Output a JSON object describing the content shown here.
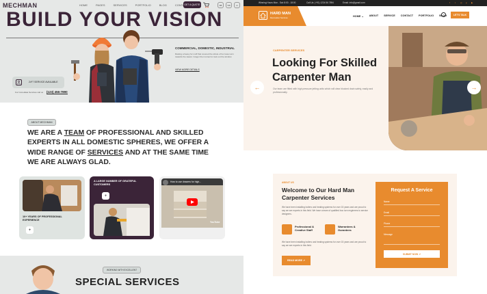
{
  "mechman": {
    "logo": "MECHMAN",
    "nav": [
      "HOME",
      "PAGES",
      "SERVICES",
      "PORTFOLIO",
      "BLOG",
      "CONTACT"
    ],
    "cta": "GET A QUOTE",
    "social": [
      "FB",
      "TW",
      "LI"
    ],
    "hero_title": "BUILD YOUR VISION",
    "hero_side_heading": "COMMERCIAL, DOMESTIC, INDUSTRIAL",
    "hero_side_text": "Raising a heavy fur muff that covered the whole of her lower arm towards the viewer. Gregor then turned to look out the window.",
    "hero_side_link": "VIEW MORE DETAILS",
    "badge_text": "24*7 SERVICE AVAILABLE",
    "phone_label": "For Immediate Services call us",
    "phone_number": "(123) 456-7890",
    "about_tag": "ABOUT MECHMAN",
    "about_text_1": "WE ARE A ",
    "about_text_team": "TEAM",
    "about_text_2": " OF PROFESSIONAL AND SKILLED EXPERTS IN ALL DOMESTIC SPHERES, WE OFFER A WIDE RANGE OF ",
    "about_text_services": "SERVICES",
    "about_text_3": " AND AT THE SAME TIME WE ARE ALWAYS GLAD.",
    "card1_text": "10+ YEARS OF PROFESSIONAL EXPERIENCE",
    "card2_text": "A LARGE NUMBER OF GRATEFUL CUSTOMERS",
    "card3_video_title": "How to use drawers for high...",
    "card3_brand": "YouTube",
    "special_tag": "WORKING WITH EXCELLENT",
    "special_title": "SPECIAL SERVICES"
  },
  "hardman": {
    "topbar_address": "Winning Hours Mon - Sat: 8:00 - 18:00",
    "topbar_phone": "Call Us: (+91) 1234 56 7894",
    "topbar_email": "Email: info@gmail.com",
    "logo_title": "HARD MAN",
    "logo_sub": "Renovation Services",
    "nav": [
      "HOME ⌄",
      "ABOUT",
      "SERVICE",
      "CONTACT",
      "PORTFOLIO",
      "BLOG"
    ],
    "cta": "LET'S TALK",
    "hero_sub": "CARPENTER SERVICES",
    "hero_title": "Looking For Skilled Carpenter Man",
    "hero_text": "Our team are fitted with high pressure jetting units which will clear blocked drain safely, easily and professionally.",
    "about_sub": "ABOUT US",
    "about_title": "Welcome to Our Hard Man Carpenter Services",
    "about_text_1": "We have been installing boilers and heating systems for over 15 years and are proud to say we are experts in this field. We have a team of qualified boo turn engineers to service designers.",
    "feature1": "Professional & Creative Staff",
    "feature2": "Warrantees & Gurantees",
    "about_text_2": "We have been installing boilers and heating systems for over 15 years and are proud to say we are experts in this field.",
    "read_more": "READ MORE ↗",
    "form_title": "Request A Service",
    "form_fields": [
      "Name",
      "Email",
      "Phone",
      "Message"
    ],
    "form_submit": "SUBMIT NOW ↗"
  },
  "colors": {
    "mechman_dark": "#3b2438",
    "mechman_bg": "#e6e8e7",
    "hardman_accent": "#e88b2e",
    "hardman_bg": "#fbf3ec"
  }
}
